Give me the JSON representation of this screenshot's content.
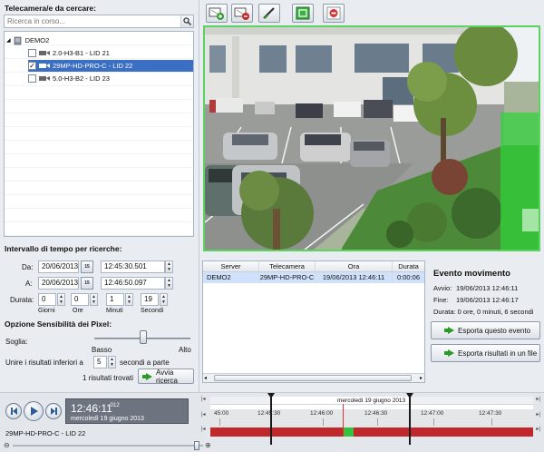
{
  "search": {
    "title": "Telecamera/e da cercare:",
    "placeholder": "Ricerca in corso..."
  },
  "tree": {
    "root": "DEMO2",
    "cameras": [
      {
        "label": "2.0-H3-B1 - LID 21",
        "checked": false,
        "selected": false
      },
      {
        "label": "29MP-HD-PRO-C - LID 22",
        "checked": true,
        "selected": true
      },
      {
        "label": "5.0-H3-B2 - LID 23",
        "checked": false,
        "selected": false
      }
    ]
  },
  "time": {
    "title": "Intervallo di tempo per ricerche:",
    "from_label": "Da:",
    "from_date": "20/06/2013",
    "from_time": "12:45:30.501",
    "to_label": "A:",
    "to_date": "20/06/2013",
    "to_time": "12:46:50.097",
    "cal_label": "15",
    "duration_label": "Durata:",
    "duration": {
      "days": "0",
      "hours": "0",
      "minutes": "1",
      "seconds": "19"
    },
    "unit_labels": {
      "days": "Giorni",
      "hours": "Ore",
      "minutes": "Minuti",
      "seconds": "Secondi"
    }
  },
  "sensitivity": {
    "title": "Opzione Sensibilità dei Pixel:",
    "threshold_label": "Soglia:",
    "low": "Basso",
    "high": "Alto",
    "merge_label": "Unire i risultati inferiori a",
    "merge_value": "5",
    "merge_unit": "secondi a parte",
    "results_found": "1 risultati trovati",
    "search_button": "Avvia ricerca"
  },
  "results_table": {
    "columns": [
      "Server",
      "Telecamera",
      "Ora",
      "Durata"
    ],
    "rows": [
      {
        "server": "DEMO2",
        "camera": "29MP-HD-PRO-C",
        "time": "19/06/2013 12:46:11",
        "duration": "0:00:06"
      }
    ]
  },
  "event": {
    "title": "Evento movimento",
    "start_label": "Avvio:",
    "start": "19/06/2013 12:46:11",
    "end_label": "Fine:",
    "end": "19/06/2013 12:46:17",
    "duration": "Durata: 0 ore, 0 minuti, 6 secondi",
    "export_event": "Esporta questo evento",
    "export_results": "Esporta risultati in un file"
  },
  "playback": {
    "time": "12:46:11",
    "ms": ".012",
    "date": "mercoledì 19 giugno 2013",
    "camera": "29MP-HD-PRO-C - LID 22"
  },
  "timeline": {
    "date_label": "mercoledì 19 giugno 2013",
    "ticks": [
      "45:00",
      "12:45:30",
      "12:46:00",
      "12:46:30",
      "12:47:00",
      "12:47:30"
    ]
  },
  "colors": {
    "selection": "#3a6fc3",
    "motion_green": "#5ed25e",
    "timeline_red": "#c0282c"
  }
}
